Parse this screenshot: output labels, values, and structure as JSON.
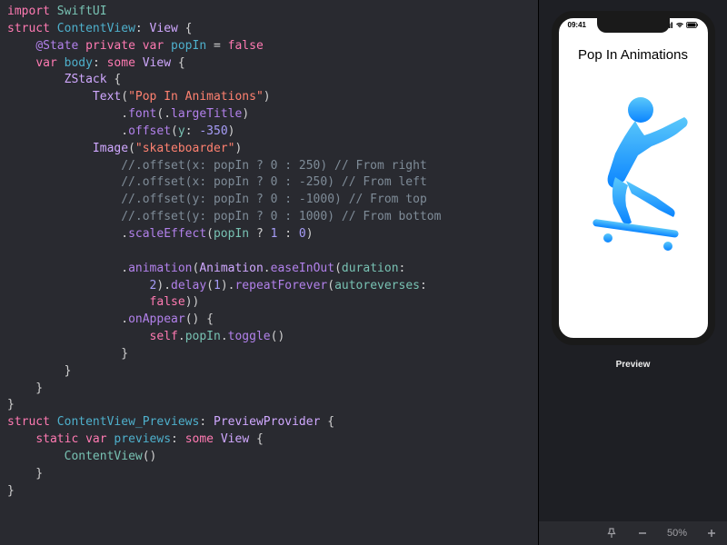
{
  "code": {
    "l1_import": "import",
    "l1_mod": "SwiftUI",
    "l2_struct": "struct",
    "l2_name": "ContentView",
    "l2_proto": "View",
    "l3_at": "@State",
    "l3_priv": "private var",
    "l3_var": "popIn",
    "l3_eq": " = ",
    "l3_false": "false",
    "l4_var": "var",
    "l4_body": "body",
    "l4_some": "some",
    "l4_view": "View",
    "l5_zstack": "ZStack",
    "l6_text": "Text",
    "l6_str": "\"Pop In Animations\"",
    "l7_font": "font",
    "l7_lt": "largeTitle",
    "l8_off": "offset",
    "l8_y": "y",
    "l8_val": "-350",
    "l9_img": "Image",
    "l9_str": "\"skateboarder\"",
    "c1": "//.offset(x: popIn ? 0 : 250) // From right",
    "c2": "//.offset(x: popIn ? 0 : -250) // From left",
    "c3": "//.offset(y: popIn ? 0 : -1000) // From top",
    "c4": "//.offset(y: popIn ? 0 : 1000) // From bottom",
    "l14_scale": "scaleEffect",
    "l14_pop": "popIn",
    "l14_q1": "1",
    "l14_q0": "0",
    "l16_anim": "animation",
    "l16_Animation": "Animation",
    "l16_ease": "easeInOut",
    "l16_dur": "duration",
    "l17_two": "2",
    "l17_delay": "delay",
    "l17_one": "1",
    "l17_repeat": "repeatForever",
    "l17_auto": "autoreverses",
    "l18_false": "false",
    "l19_onapp": "onAppear",
    "l20_self": "self",
    "l20_pop": "popIn",
    "l20_tog": "toggle",
    "lp_struct": "struct",
    "lp_name": "ContentView_Previews",
    "lp_proto": "PreviewProvider",
    "lp_static": "static var",
    "lp_prev": "previews",
    "lp_some": "some",
    "lp_view": "View",
    "lp_cv": "ContentView"
  },
  "preview": {
    "time": "09:41",
    "title": "Pop In Animations",
    "label": "Preview",
    "zoom": "50%"
  }
}
